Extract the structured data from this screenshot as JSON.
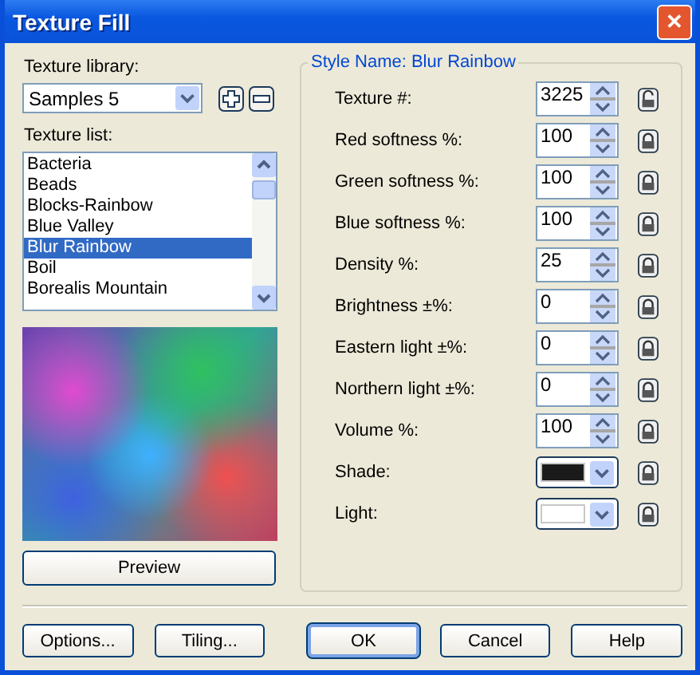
{
  "window": {
    "title": "Texture Fill",
    "close": "✕"
  },
  "library": {
    "label": "Texture library:",
    "value": "Samples 5"
  },
  "texture_list": {
    "label": "Texture list:",
    "items": [
      {
        "label": "Bacteria",
        "selected": false
      },
      {
        "label": "Beads",
        "selected": false
      },
      {
        "label": "Blocks-Rainbow",
        "selected": false
      },
      {
        "label": "Blue Valley",
        "selected": false
      },
      {
        "label": "Blur Rainbow",
        "selected": true
      },
      {
        "label": "Boil",
        "selected": false
      },
      {
        "label": "Borealis Mountain",
        "selected": false
      }
    ]
  },
  "preview_button": "Preview",
  "style": {
    "title": "Style Name: Blur Rainbow",
    "rows": [
      {
        "kind": "spin",
        "label": "Texture #:",
        "value": "3225",
        "locked": false
      },
      {
        "kind": "spin",
        "label": "Red softness %:",
        "value": "100",
        "locked": true
      },
      {
        "kind": "spin",
        "label": "Green softness %:",
        "value": "100",
        "locked": true
      },
      {
        "kind": "spin",
        "label": "Blue softness %:",
        "value": "100",
        "locked": true
      },
      {
        "kind": "spin",
        "label": "Density %:",
        "value": "25",
        "locked": true
      },
      {
        "kind": "spin",
        "label": "Brightness ±%:",
        "value": "0",
        "locked": true
      },
      {
        "kind": "spin",
        "label": "Eastern light ±%:",
        "value": "0",
        "locked": true
      },
      {
        "kind": "spin",
        "label": "Northern light ±%:",
        "value": "0",
        "locked": true
      },
      {
        "kind": "spin",
        "label": "Volume %:",
        "value": "100",
        "locked": true
      },
      {
        "kind": "color",
        "label": "Shade:",
        "color": "#1a1a1a",
        "locked": true
      },
      {
        "kind": "color",
        "label": "Light:",
        "color": "#ffffff",
        "locked": true
      }
    ]
  },
  "buttons": [
    {
      "label": "Options...",
      "default": false
    },
    {
      "label": "Tiling...",
      "default": false
    },
    {
      "label": "OK",
      "default": true
    },
    {
      "label": "Cancel",
      "default": false
    },
    {
      "label": "Help",
      "default": false
    }
  ]
}
